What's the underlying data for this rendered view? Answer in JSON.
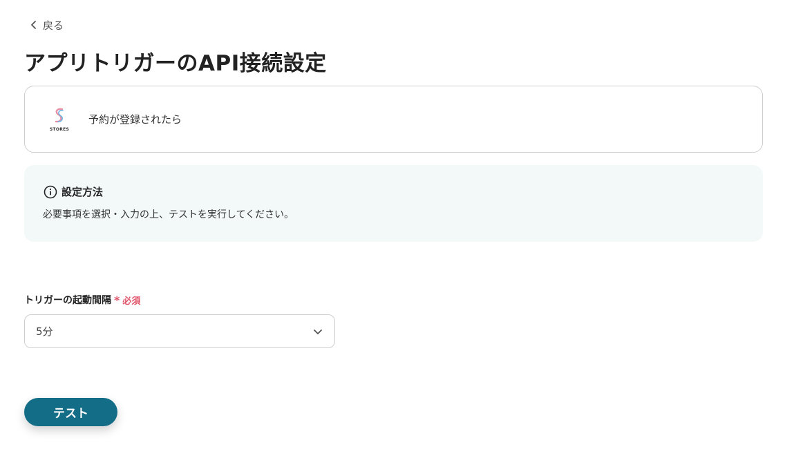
{
  "nav": {
    "back_label": "戻る"
  },
  "page": {
    "title": "アプリトリガーのAPI接続設定"
  },
  "app_card": {
    "logo_text": "STORES",
    "trigger_name": "予約が登録されたら"
  },
  "info": {
    "title": "設定方法",
    "text": "必要事項を選択・入力の上、テストを実行してください。"
  },
  "field": {
    "label": "トリガーの起動間隔",
    "required_star": "*",
    "required_text": "必須",
    "value": "5分"
  },
  "actions": {
    "test_label": "テスト"
  },
  "colors": {
    "primary": "#136d86",
    "required": "#e0546a",
    "info_bg": "#f2f9f8"
  }
}
